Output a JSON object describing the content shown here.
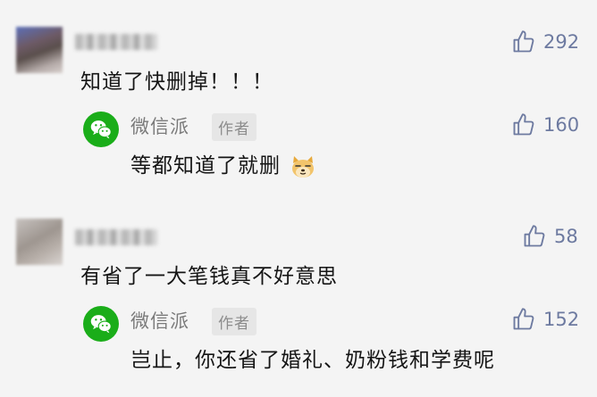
{
  "comments": [
    {
      "text": "知道了快删掉！！！",
      "likes": "292",
      "reply": {
        "author": "微信派",
        "badge": "作者",
        "text": "等都知道了就删",
        "emoji": "doge-emoji",
        "likes": "160"
      }
    },
    {
      "text": "有省了一大笔钱真不好意思",
      "likes": "58",
      "reply": {
        "author": "微信派",
        "badge": "作者",
        "text": "岂止，你还省了婚礼、奶粉钱和学费呢",
        "likes": "152"
      }
    }
  ],
  "colors": {
    "background": "#f4f4f4",
    "like": "#6d7aa0",
    "wechat_green": "#1aad19"
  },
  "icons": {
    "like": "thumbs-up-icon",
    "author_logo": "wechat-logo-icon"
  }
}
